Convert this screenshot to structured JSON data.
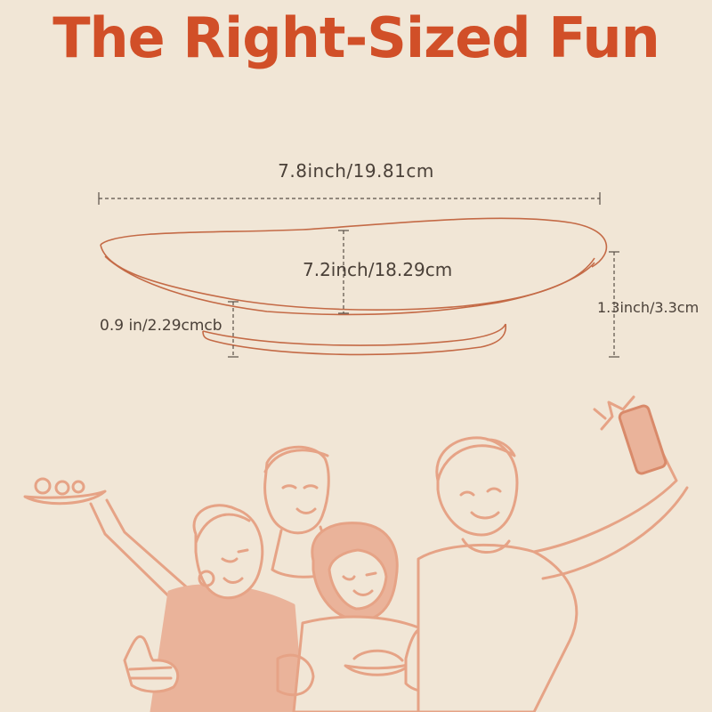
{
  "title": "The Right-Sized Fun",
  "dimensions": {
    "width": "7.8inch/19.81cm",
    "depth": "7.2inch/18.29cm",
    "height": "1.3inch/3.3cm",
    "foot_height": "0.9 in/2.29cmcb"
  },
  "colors": {
    "background": "#f1e6d6",
    "title": "#d14f28",
    "plate_outline": "#c46a46",
    "illustration": "#e6a386",
    "illustration_fill": "#eab39a",
    "dimension_lines": "#5a5048"
  }
}
